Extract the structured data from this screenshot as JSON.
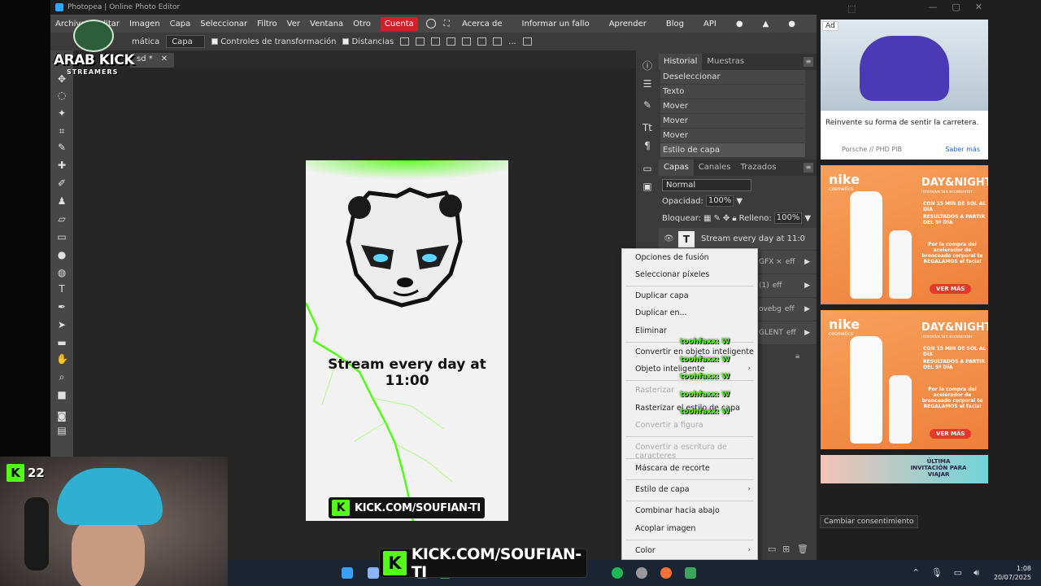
{
  "browser": {
    "title": "Photopea | Online Photo Editor"
  },
  "menubar": {
    "items": [
      "Archivo",
      "Editar",
      "Imagen",
      "Capa",
      "Seleccionar",
      "Filtro",
      "Ver",
      "Ventana",
      "Otro"
    ],
    "account": "Cuenta",
    "right": [
      "Acerca de",
      "Informar un fallo",
      "Aprender",
      "Blog",
      "API"
    ]
  },
  "optionsbar": {
    "auto_select_label": "mática",
    "target_select": "Capa",
    "transform_controls": "Controles de transformación",
    "distances": "Distancias",
    "more": "..."
  },
  "document_tab": {
    "name": "sd *",
    "close": "✕"
  },
  "canvas": {
    "title_text": "Stream every day at 11:00",
    "kick_badge": "K",
    "kick_url": "KICK.COM/SOUFIAN-TI"
  },
  "history_panel": {
    "tabs": [
      "Historial",
      "Muestras"
    ],
    "menu": "≡",
    "items": [
      "Deseleccionar",
      "Texto",
      "Mover",
      "Mover",
      "Mover",
      "Estilo de capa"
    ]
  },
  "layers_panel": {
    "tabs": [
      "Capas",
      "Canales",
      "Trazados"
    ],
    "menu": "≡",
    "blend_mode": "Normal",
    "opacity_label": "Opacidad:",
    "opacity_value": "100%",
    "lock_label": "Bloquear:",
    "fill_label": "Relleno:",
    "fill_value": "100%",
    "top_layer": {
      "thumb": "T",
      "name": "Stream every day at 11:0"
    },
    "partial_layers": [
      {
        "name": "GFX ×",
        "fx": "eff"
      },
      {
        "name": "(1)",
        "fx": "eff"
      },
      {
        "name": "ovebg",
        "fx": "eff"
      },
      {
        "name": "GLENT",
        "fx": "eff"
      }
    ]
  },
  "context_menu": {
    "items": [
      {
        "label": "Opciones de fusión",
        "disabled": false
      },
      {
        "label": "Seleccionar píxeles",
        "disabled": false
      },
      {
        "label": "Duplicar capa",
        "disabled": false
      },
      {
        "label": "Duplicar en...",
        "disabled": false
      },
      {
        "label": "Eliminar",
        "disabled": false
      },
      {
        "label": "Convertir en objeto inteligente",
        "disabled": false
      },
      {
        "label": "Objeto inteligente",
        "disabled": false
      },
      {
        "label": "Rasterizar",
        "disabled": true
      },
      {
        "label": "Rasterizar el estilo de capa",
        "disabled": false
      },
      {
        "label": "Convertir a figura",
        "disabled": true
      },
      {
        "label": "Convertir a escritura de caracteres",
        "disabled": true
      },
      {
        "label": "Máscara de recorte",
        "disabled": false
      },
      {
        "label": "Estilo de capa",
        "disabled": false
      },
      {
        "label": "Combinar hacia abajo",
        "disabled": false
      },
      {
        "label": "Acoplar imagen",
        "disabled": false
      },
      {
        "label": "Color",
        "disabled": false
      }
    ],
    "submenu_arrow": "›"
  },
  "chat_overlay": {
    "name": "toohfaxx:",
    "emote": "W"
  },
  "ads": {
    "ad_label": "Ad",
    "porsche": {
      "text": "Reinvente su forma de sentir la carretera.",
      "brand": "Porsche // PHD PIB",
      "cta": "Saber más"
    },
    "nike": {
      "logo": "nike",
      "logo_sub": "cosmetics",
      "headline": "DAY&NIGHT",
      "headline_sub": "Intensive tan accelerator",
      "promo1": "CON 15 MIN DE SOL AL DÍA",
      "promo2": "RESULTADOS A PARTIR DEL 5º DÍA",
      "promo3": "Por la compra del acelerador de bronceado corporal te REGALAMOS el facial",
      "cta": "VER MÁS"
    },
    "travel": {
      "text": "ÚLTIMA INVITACIÓN PARA VIAJAR"
    },
    "consent_button": "Cambiar consentimiento"
  },
  "stream_overlay": {
    "logo_line1": "ARAB KICK",
    "logo_line2": "STREAMERS",
    "viewer_badge": "K",
    "viewer_count": "22",
    "kick_badge": "K",
    "kick_url": "KICK.COM/SOUFIAN-TI"
  },
  "taskbar": {
    "time": "1:08",
    "date": "20/07/2025"
  },
  "colors": {
    "kick_green": "#53fc18",
    "account_red": "#d21f2b",
    "panel_bg": "#3b3b3b",
    "workspace_bg": "#262626"
  }
}
